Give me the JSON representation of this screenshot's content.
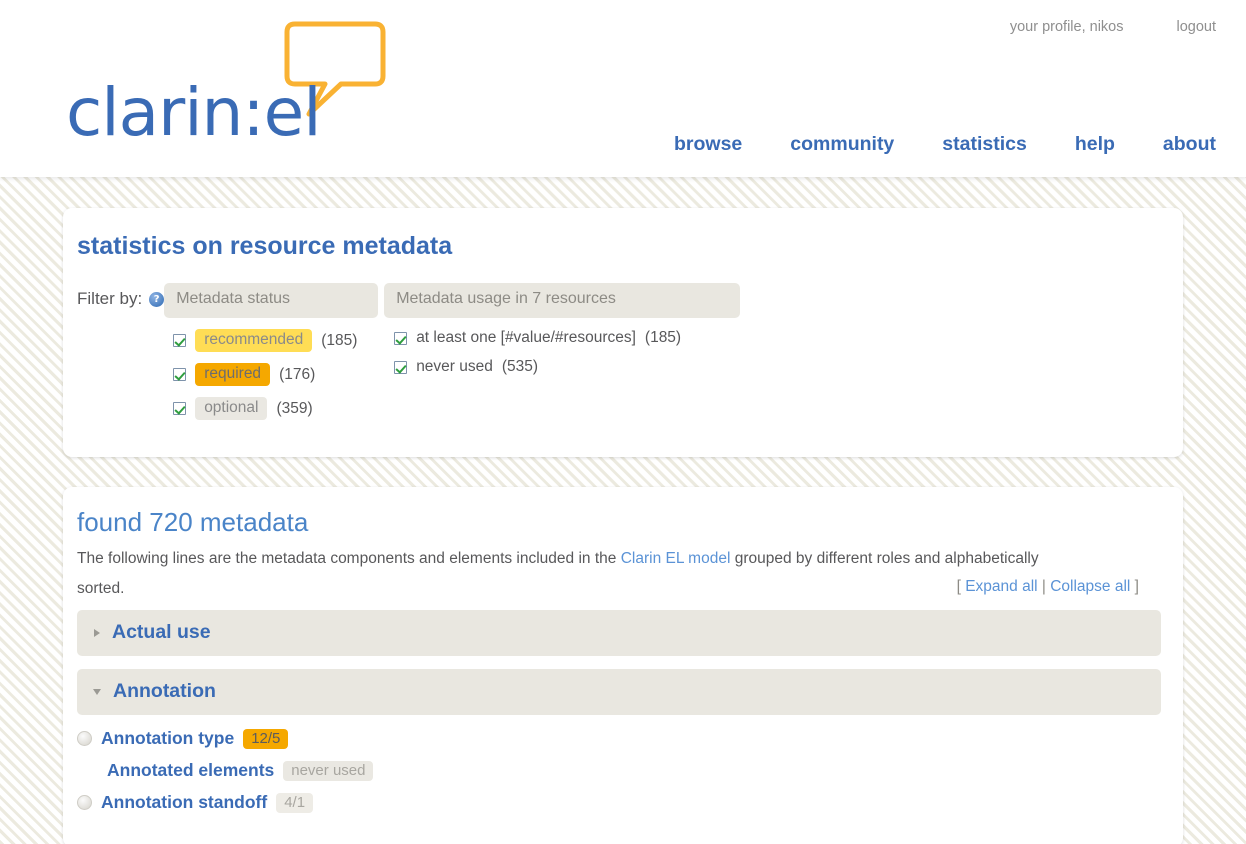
{
  "header": {
    "logo_text": "clarin:el",
    "logo_icon": "speech-bubble-icon",
    "user_links": [
      {
        "label": "your profile, nikos",
        "name": "profile-link"
      },
      {
        "label": "logout",
        "name": "logout-link"
      }
    ],
    "nav": [
      {
        "label": "browse"
      },
      {
        "label": "community"
      },
      {
        "label": "statistics"
      },
      {
        "label": "help"
      },
      {
        "label": "about"
      }
    ]
  },
  "filters": {
    "page_title": "statistics on resource metadata",
    "filter_by_label": "Filter by:",
    "help_icon_glyph": "?",
    "columns": [
      {
        "head": "Metadata status",
        "options": [
          {
            "tag": "recommended",
            "count": "(185)",
            "style": "recommended",
            "checked": true
          },
          {
            "tag": "required",
            "count": "(176)",
            "style": "required",
            "checked": true
          },
          {
            "tag": "optional",
            "count": "(359)",
            "style": "optional",
            "checked": true
          }
        ]
      },
      {
        "head": "Metadata usage in 7 resources",
        "options": [
          {
            "tag": "at least one [#value/#resources]",
            "count": "(185)",
            "style": "plain",
            "checked": true
          },
          {
            "tag": "never used",
            "count": "(535)",
            "style": "plain",
            "checked": true
          }
        ]
      }
    ]
  },
  "results": {
    "found_title": "found 720 metadata",
    "intro_part1": "The following lines are the metadata components and elements included in the ",
    "intro_link": "Clarin EL model",
    "intro_part2": " grouped by different roles and alphabetically sorted.",
    "expand_open_bracket": "[ ",
    "expand_all": "Expand all",
    "expand_sep": " | ",
    "collapse_all": "Collapse all",
    "expand_close_bracket": " ]",
    "accordions": [
      {
        "label": "Actual use",
        "expanded": false,
        "icon": "chevron-right-icon"
      },
      {
        "label": "Annotation",
        "expanded": true,
        "icon": "chevron-down-icon"
      }
    ],
    "tree": [
      {
        "label": "Annotation type",
        "badge": "12/5",
        "badge_style": "orange",
        "has_radio": true,
        "indent": false
      },
      {
        "label": "Annotated elements",
        "badge": "never used",
        "badge_style": "grey",
        "has_radio": false,
        "indent": true
      },
      {
        "label": "Annotation standoff",
        "badge": "4/1",
        "badge_style": "lightgrey",
        "has_radio": true,
        "indent": false
      }
    ]
  },
  "colors": {
    "brand_blue": "#3a6bb5",
    "link_blue": "#5b93d6",
    "accent_orange": "#f5a800",
    "accent_yellow": "#ffdd55",
    "neutral_grey": "#e9e7e0"
  }
}
